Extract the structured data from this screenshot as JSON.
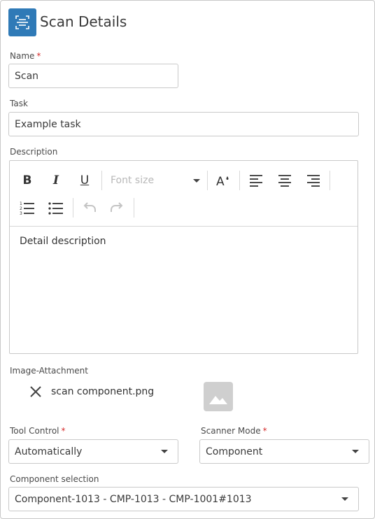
{
  "header": {
    "title": "Scan Details",
    "icon": "scan-document-icon"
  },
  "name_field": {
    "label": "Name",
    "required_mark": "*",
    "value": "Scan"
  },
  "task_field": {
    "label": "Task",
    "value": "Example task"
  },
  "description": {
    "label": "Description",
    "toolbar": {
      "font_size_placeholder": "Font size",
      "bold": "B",
      "italic": "I",
      "underline": "U"
    },
    "content": "Detail description"
  },
  "image_attachment": {
    "label": "Image-Attachment",
    "filename": "scan component.png"
  },
  "tool_control": {
    "label": "Tool Control",
    "required_mark": "*",
    "value": "Automatically"
  },
  "scanner_mode": {
    "label": "Scanner Mode",
    "required_mark": "*",
    "value": "Component"
  },
  "component_selection": {
    "label": "Component selection",
    "value": "Component-1013 - CMP-1013 - CMP-1001#1013"
  },
  "colors": {
    "accent": "#2f7ab7",
    "required": "#d62e2e"
  }
}
